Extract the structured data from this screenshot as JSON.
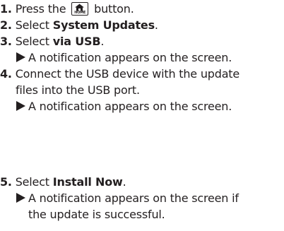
{
  "steps": [
    {
      "number": "1.",
      "text_before": "Press the",
      "icon": "home-button-icon",
      "icon_label": "HOME",
      "text_after": "button."
    },
    {
      "number": "2.",
      "text_before": "Select",
      "bold": "System Updates",
      "text_after": "."
    },
    {
      "number": "3.",
      "text_before": "Select",
      "bold": "via USB",
      "text_after": ".",
      "result": "A notification appears on the screen."
    },
    {
      "number": "4.",
      "line1": "Connect the USB device with the update",
      "line2": "files into the USB port.",
      "result": "A notification appears on the screen."
    },
    {
      "number": "5.",
      "text_before": "Select",
      "bold": "Install Now",
      "text_after": ".",
      "result_line1": "A notification appears on the screen if",
      "result_line2": "the update is successful."
    }
  ]
}
